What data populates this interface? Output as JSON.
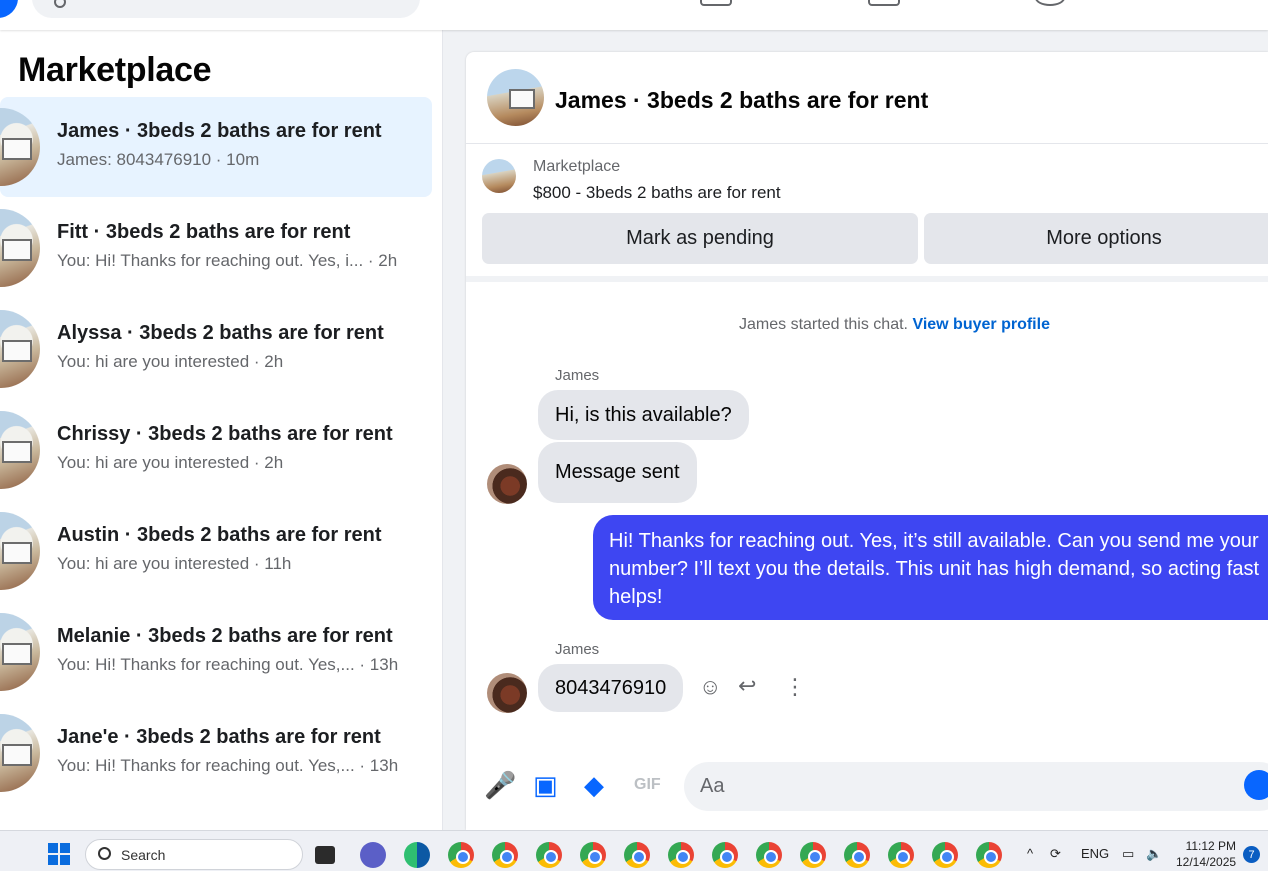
{
  "sidebar": {
    "title": "Marketplace",
    "conversations": [
      {
        "title": "James · 3beds 2 baths are for rent",
        "preview": "James: 8043476910 · 10m"
      },
      {
        "title": "Fitt · 3beds 2 baths are for rent",
        "preview": "You: Hi! Thanks for reaching out. Yes, i... · 2h"
      },
      {
        "title": "Alyssa · 3beds 2 baths are for rent",
        "preview": "You: hi are you interested · 2h"
      },
      {
        "title": "Chrissy · 3beds 2 baths are for rent",
        "preview": "You: hi are you interested · 2h"
      },
      {
        "title": "Austin · 3beds 2 baths are for rent",
        "preview": "You: hi are you interested · 11h"
      },
      {
        "title": "Melanie · 3beds 2 baths are for rent",
        "preview": "You: Hi! Thanks for reaching out. Yes,... · 13h"
      },
      {
        "title": "Jane'e · 3beds 2 baths are for rent",
        "preview": "You: Hi! Thanks for reaching out. Yes,... · 13h"
      }
    ]
  },
  "chat": {
    "title": "James · 3beds 2 baths are for rent",
    "listing": {
      "label": "Marketplace",
      "price_title": "$800 - 3beds 2 baths are for rent",
      "pending_button": "Mark as pending",
      "more_button": "More options"
    },
    "started_text": "James started this chat.",
    "buyer_profile_link": "View buyer profile",
    "messages": {
      "sender1": "James",
      "m1": "Hi, is this available?",
      "m2": "Message sent",
      "outgoing": "Hi! Thanks for reaching out. Yes, it’s still available. Can you send me your number? I’ll text you the details. This unit has high demand, so acting fast helps!",
      "sender2": "James",
      "m3": "8043476910"
    },
    "composer": {
      "placeholder": "Aa"
    }
  },
  "taskbar": {
    "search_label": "Search",
    "language": "ENG",
    "time": "11:12 PM",
    "date": "12/14/2025",
    "notification_count": "7"
  },
  "colors": {
    "accent": "#0866ff",
    "outgoing_bubble": "#3e46f2",
    "active_row": "#e7f3ff"
  }
}
